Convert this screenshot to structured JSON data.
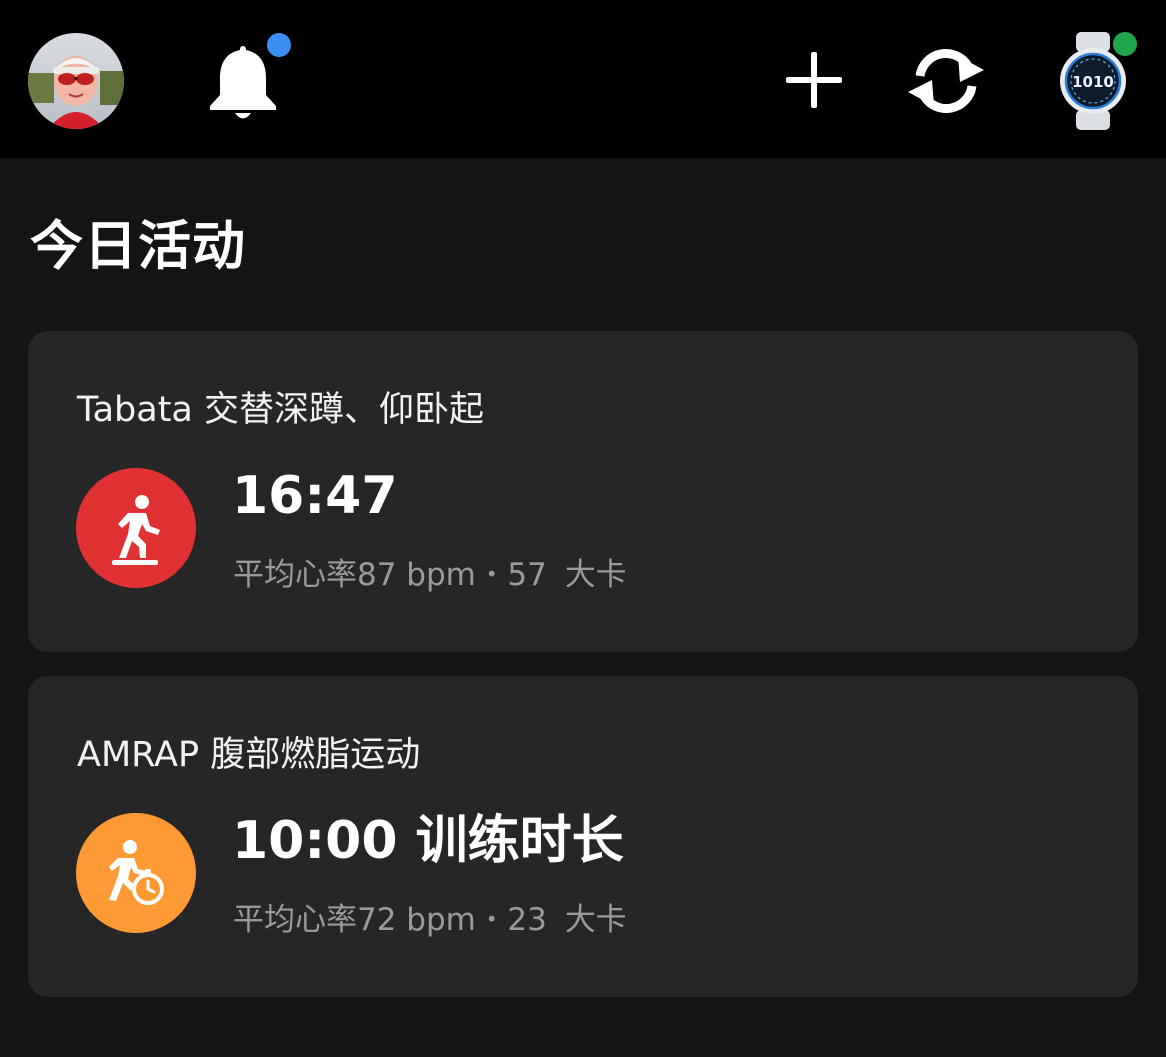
{
  "colors": {
    "background": "#141414",
    "topbar": "#000000",
    "card": "#262626",
    "strength_icon": "#e03232",
    "amrap_icon": "#ff9933",
    "notification_dot": "#3b8ff2",
    "device_connected_dot": "#1fa64a",
    "secondary_text": "#9a9a9a"
  },
  "header": {
    "avatar_icon": "profile-avatar",
    "notifications_icon": "bell-icon",
    "add_icon": "plus-icon",
    "sync_icon": "sync-icon",
    "device_icon": "smartwatch-icon"
  },
  "main": {
    "title": "今日活动",
    "activities": [
      {
        "name": "Tabata 交替深蹲、仰卧起",
        "icon": "strength-training-icon",
        "main_value": "16:47",
        "stats": {
          "hr_label": "平均心率",
          "hr_value": "87 bpm",
          "separator": "•",
          "calories_value": "57",
          "calories_unit": "大卡"
        }
      },
      {
        "name": "AMRAP 腹部燃脂运动",
        "icon": "timed-workout-icon",
        "main_value": "10:00 训练时长",
        "stats": {
          "hr_label": "平均心率",
          "hr_value": "72 bpm",
          "separator": "•",
          "calories_value": "23",
          "calories_unit": "大卡"
        }
      }
    ]
  }
}
